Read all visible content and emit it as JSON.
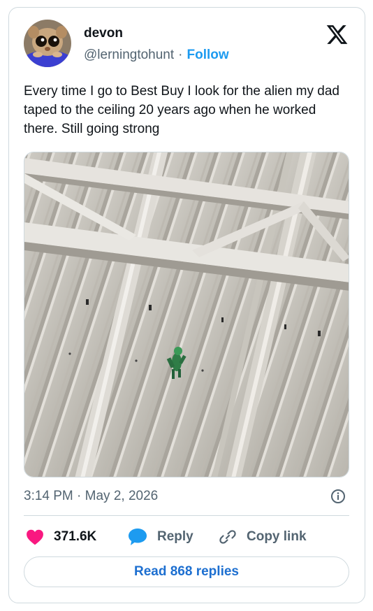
{
  "author": {
    "name": "devon",
    "handle": "@lerningtohunt",
    "separator": "·",
    "follow_label": "Follow"
  },
  "brand_icon": "x-logo-icon",
  "tweet": {
    "text": "Every time I go to Best Buy I look for the alien my dad taped to the ceiling 20 years ago when he worked there. Still going strong",
    "timestamp": "3:14 PM · May 2, 2026"
  },
  "actions": {
    "like_count": "371.6K",
    "reply_label": "Reply",
    "copy_label": "Copy link"
  },
  "read_replies_label": "Read 868 replies",
  "colors": {
    "accent": "#1d9bf0",
    "like": "#f91880",
    "secondary_text": "#536471",
    "border": "#cfd9de"
  }
}
